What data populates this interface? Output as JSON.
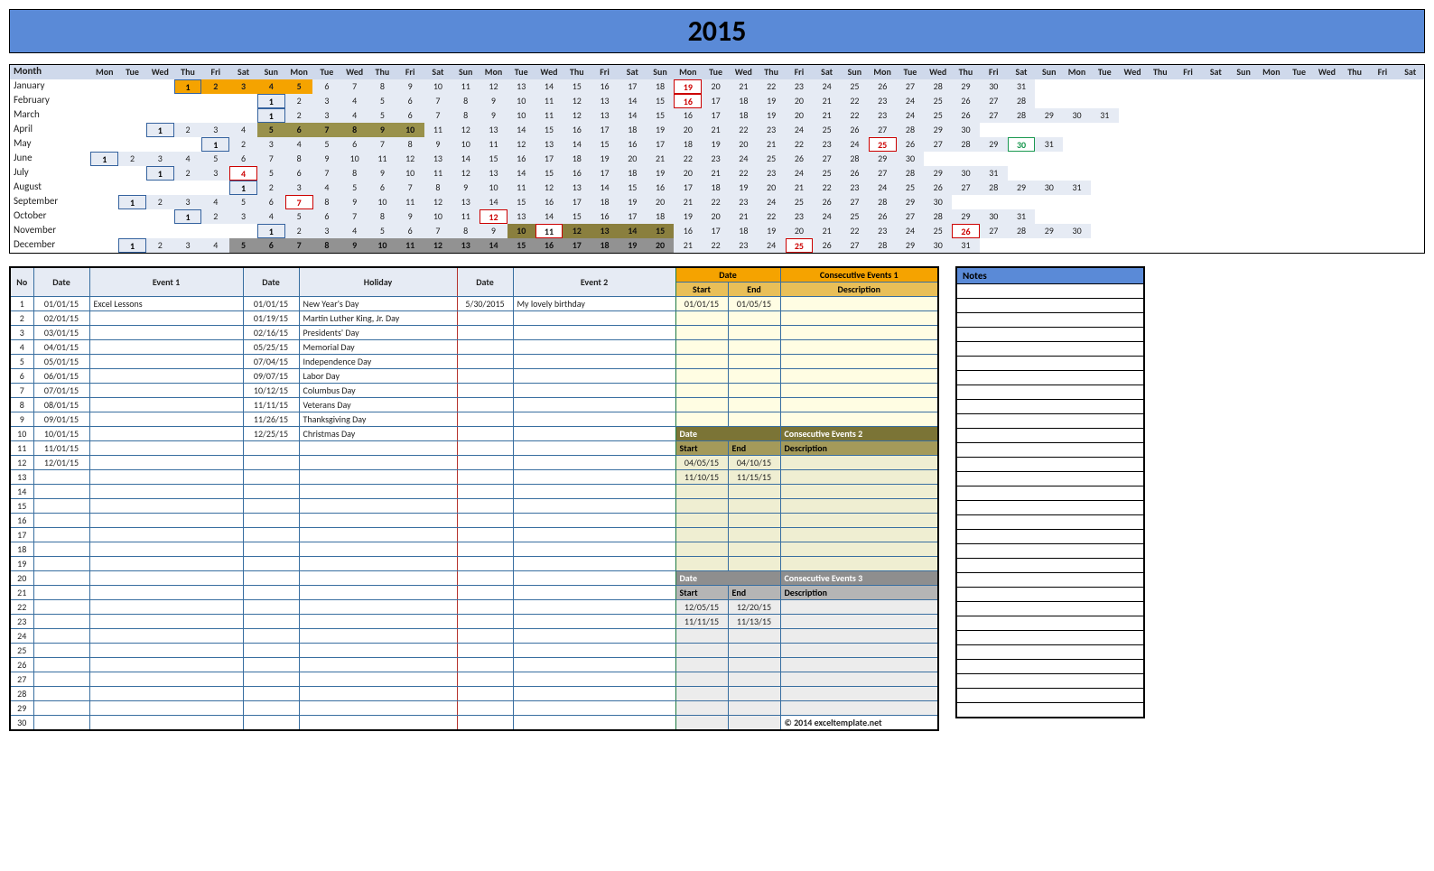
{
  "title": "2015",
  "copyright": "© 2014 exceltemplate.net",
  "notes_header": "Notes",
  "dow": [
    "Mon",
    "Tue",
    "Wed",
    "Thu",
    "Fri",
    "Sat",
    "Sun"
  ],
  "months": [
    {
      "name": "January",
      "offset": 3,
      "days": 31,
      "hl": {
        "range": [
          1,
          5
        ],
        "cls": "hl-orange"
      },
      "red": [
        19
      ]
    },
    {
      "name": "February",
      "offset": 6,
      "days": 28,
      "red": [
        16
      ]
    },
    {
      "name": "March",
      "offset": 6,
      "days": 31
    },
    {
      "name": "April",
      "offset": 2,
      "days": 30,
      "hl": {
        "range": [
          5,
          10
        ],
        "cls": "hl-olive"
      }
    },
    {
      "name": "May",
      "offset": 4,
      "days": 31,
      "red": [
        25
      ],
      "green": [
        30
      ]
    },
    {
      "name": "June",
      "offset": 0,
      "days": 30
    },
    {
      "name": "July",
      "offset": 2,
      "days": 31,
      "red": [
        4
      ]
    },
    {
      "name": "August",
      "offset": 5,
      "days": 31
    },
    {
      "name": "September",
      "offset": 1,
      "days": 30,
      "red": [
        7
      ]
    },
    {
      "name": "October",
      "offset": 3,
      "days": 31,
      "red": [
        12
      ]
    },
    {
      "name": "November",
      "offset": 6,
      "days": 30,
      "red": [
        11,
        26
      ],
      "hl": {
        "range": [
          10,
          15
        ],
        "cls": "hl-olive2"
      }
    },
    {
      "name": "December",
      "offset": 1,
      "days": 31,
      "red": [
        25
      ],
      "hl": {
        "range": [
          5,
          20
        ],
        "cls": "hl-gray"
      }
    }
  ],
  "headers": {
    "no": "No",
    "date": "Date",
    "event1": "Event 1",
    "holiday": "Holiday",
    "event2": "Event 2",
    "ce_date": "Date",
    "ce1": "Consecutive Events 1",
    "ce2": "Consecutive Events 2",
    "ce3": "Consecutive Events 3",
    "start": "Start",
    "end": "End",
    "desc": "Description",
    "month": "Month"
  },
  "event1_rows": [
    {
      "date": "01/01/15",
      "text": "Excel Lessons"
    },
    {
      "date": "02/01/15",
      "text": ""
    },
    {
      "date": "03/01/15",
      "text": ""
    },
    {
      "date": "04/01/15",
      "text": ""
    },
    {
      "date": "05/01/15",
      "text": ""
    },
    {
      "date": "06/01/15",
      "text": ""
    },
    {
      "date": "07/01/15",
      "text": ""
    },
    {
      "date": "08/01/15",
      "text": ""
    },
    {
      "date": "09/01/15",
      "text": ""
    },
    {
      "date": "10/01/15",
      "text": ""
    },
    {
      "date": "11/01/15",
      "text": ""
    },
    {
      "date": "12/01/15",
      "text": ""
    }
  ],
  "holiday_rows": [
    {
      "date": "01/01/15",
      "text": "New Year's Day"
    },
    {
      "date": "01/19/15",
      "text": "Martin Luther King, Jr. Day"
    },
    {
      "date": "02/16/15",
      "text": "Presidents' Day"
    },
    {
      "date": "05/25/15",
      "text": "Memorial Day"
    },
    {
      "date": "07/04/15",
      "text": "Independence Day"
    },
    {
      "date": "09/07/15",
      "text": "Labor Day"
    },
    {
      "date": "10/12/15",
      "text": "Columbus Day"
    },
    {
      "date": "11/11/15",
      "text": "Veterans Day"
    },
    {
      "date": "11/26/15",
      "text": "Thanksgiving Day"
    },
    {
      "date": "12/25/15",
      "text": "Christmas Day"
    }
  ],
  "event2_rows": [
    {
      "date": "5/30/2015",
      "text": "My lovely birthday"
    }
  ],
  "ce1_rows": [
    {
      "start": "01/01/15",
      "end": "01/05/15",
      "desc": ""
    }
  ],
  "ce2_rows": [
    {
      "start": "04/05/15",
      "end": "04/10/15",
      "desc": ""
    },
    {
      "start": "11/10/15",
      "end": "11/15/15",
      "desc": ""
    }
  ],
  "ce3_rows": [
    {
      "start": "12/05/15",
      "end": "12/20/15",
      "desc": ""
    },
    {
      "start": "11/11/15",
      "end": "11/13/15",
      "desc": ""
    }
  ],
  "total_rows": 30
}
